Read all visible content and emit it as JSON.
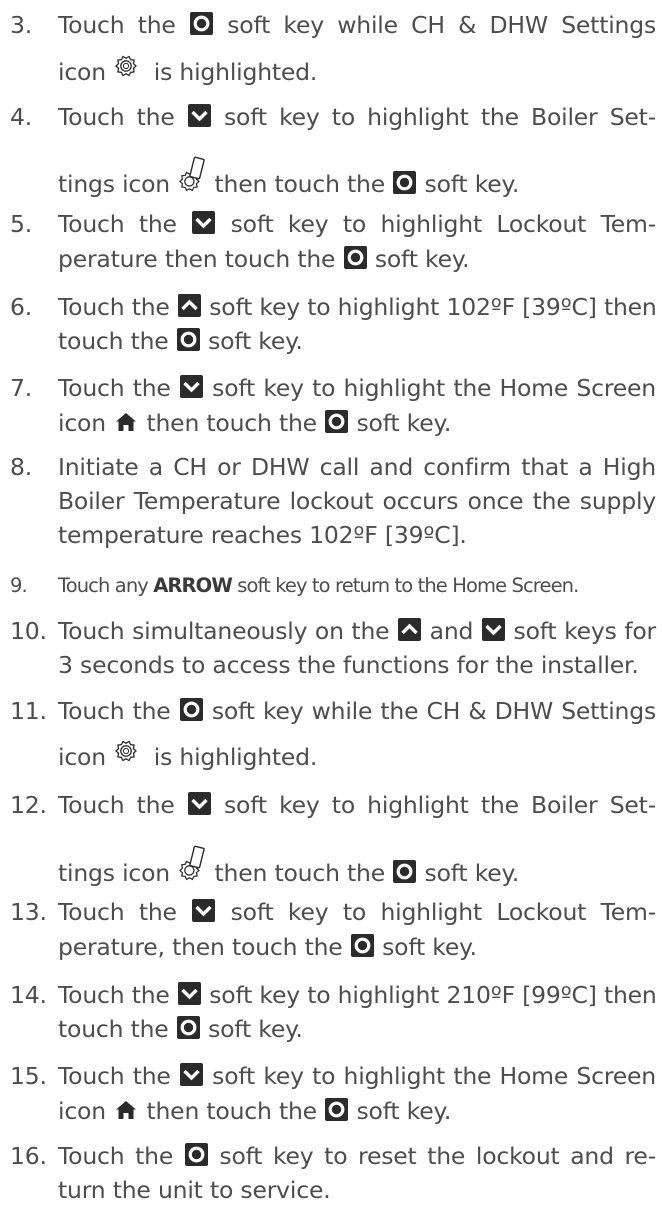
{
  "steps": [
    {
      "number": "3.",
      "lines": [
        [
          "Touch the ",
          "{key:circle}",
          " soft key while CH & DHW Settings"
        ],
        [
          "icon ",
          "{icon:gear}",
          "  is highlighted."
        ]
      ]
    },
    {
      "number": "4.",
      "lines": [
        [
          "Touch the ",
          "{key:down}",
          " soft key to highlight the Boiler Set-"
        ],
        [
          "tings icon ",
          "{icon:boiler}",
          " then touch the ",
          "{key:circle}",
          " soft key."
        ]
      ]
    },
    {
      "number": "5.",
      "lines": [
        [
          "Touch the ",
          "{key:down}",
          " soft key to highlight Lockout Tem-"
        ],
        [
          "perature then touch the ",
          "{key:circle}",
          " soft key."
        ]
      ]
    },
    {
      "number": "6.",
      "lines": [
        [
          "Touch the ",
          "{key:up}",
          " soft key to highlight 102ºF [39ºC] then"
        ],
        [
          "touch the ",
          "{key:circle}",
          " soft key."
        ]
      ]
    },
    {
      "number": "7.",
      "lines": [
        [
          "Touch the ",
          "{key:down}",
          " soft key to highlight the Home Screen"
        ],
        [
          "icon ",
          "{icon:home}",
          " then touch the ",
          "{key:circle}",
          " soft key."
        ]
      ]
    },
    {
      "number": "8.",
      "lines": [
        [
          "Initiate a CH or DHW call and confirm that a High"
        ],
        [
          "Boiler Temperature lockout occurs once the supply"
        ],
        [
          "temperature reaches 102ºF [39ºC]."
        ]
      ]
    },
    {
      "number": "9.",
      "condensed": true,
      "lines": [
        [
          "Touch any ",
          "{bold:ARROW}",
          " soft key to return to the Home Screen."
        ]
      ]
    },
    {
      "number": "10.",
      "lines": [
        [
          "Touch simultaneously on the ",
          "{key:up}",
          " and ",
          "{key:down}",
          " soft keys for"
        ],
        [
          "3 seconds to access the functions for the installer."
        ]
      ]
    },
    {
      "number": "11.",
      "lines": [
        [
          "Touch the ",
          "{key:circle}",
          " soft key while the CH & DHW Settings"
        ],
        [
          "icon ",
          "{icon:gear}",
          "  is highlighted."
        ]
      ]
    },
    {
      "number": "12.",
      "lines": [
        [
          "Touch the ",
          "{key:down}",
          " soft key to highlight the Boiler Set-"
        ],
        [
          "tings icon ",
          "{icon:boiler}",
          " then touch the ",
          "{key:circle}",
          " soft key."
        ]
      ]
    },
    {
      "number": "13.",
      "lines": [
        [
          "Touch the ",
          "{key:down}",
          " soft key to highlight Lockout Tem-"
        ],
        [
          "perature, then touch the ",
          "{key:circle}",
          " soft key."
        ]
      ]
    },
    {
      "number": "14.",
      "lines": [
        [
          "Touch the ",
          "{key:down}",
          " soft key to highlight 210ºF [99ºC] then"
        ],
        [
          "touch the ",
          "{key:circle}",
          " soft key."
        ]
      ]
    },
    {
      "number": "15.",
      "lines": [
        [
          "Touch the ",
          "{key:down}",
          " soft key to highlight the Home Screen"
        ],
        [
          "icon ",
          "{icon:home}",
          " then touch the ",
          "{key:circle}",
          " soft key."
        ]
      ]
    },
    {
      "number": "16.",
      "lines": [
        [
          "Touch the ",
          "{key:circle}",
          " soft key to reset the lockout and re-"
        ],
        [
          "turn the unit to service."
        ]
      ]
    }
  ]
}
